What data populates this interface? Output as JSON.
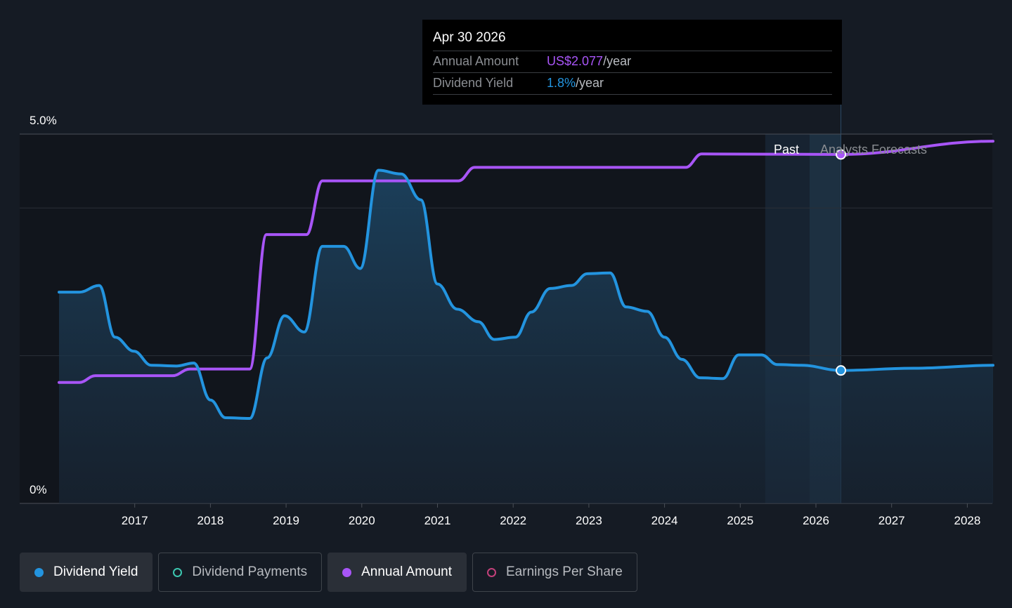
{
  "tooltip": {
    "date": "Apr 30 2026",
    "rows": [
      {
        "label": "Annual Amount",
        "value": "US$2.077",
        "unit": "/year",
        "color": "#a855f7"
      },
      {
        "label": "Dividend Yield",
        "value": "1.8%",
        "unit": "/year",
        "color": "#2394df"
      }
    ]
  },
  "chart_data": {
    "type": "line",
    "y_tick_labels": [
      "5.0%",
      "0%"
    ],
    "ylim": [
      0,
      5.0
    ],
    "yunit": "%",
    "x_tick_labels": [
      "2017",
      "2018",
      "2019",
      "2020",
      "2021",
      "2022",
      "2023",
      "2024",
      "2025",
      "2026",
      "2027",
      "2028"
    ],
    "xlim": [
      2016.0,
      2028.34
    ],
    "regions": {
      "past_label": "Past",
      "forecast_label": "Analysts Forecasts",
      "past_start": 2025.33,
      "forecast_start": 2026.33
    },
    "series": [
      {
        "name": "Dividend Yield",
        "color": "#2394df",
        "unit": "%",
        "x": [
          2016.0,
          2016.27,
          2016.53,
          2016.74,
          2016.99,
          2017.22,
          2017.55,
          2017.78,
          2018.0,
          2018.2,
          2018.52,
          2018.75,
          2018.98,
          2019.24,
          2019.48,
          2019.76,
          2019.98,
          2020.22,
          2020.52,
          2020.78,
          2021.0,
          2021.26,
          2021.54,
          2021.75,
          2022.03,
          2022.24,
          2022.49,
          2022.77,
          2022.98,
          2023.28,
          2023.49,
          2023.77,
          2024.0,
          2024.23,
          2024.47,
          2024.77,
          2024.98,
          2025.28,
          2025.49,
          2025.81,
          2026.33,
          2027.3,
          2028.34
        ],
        "values": [
          2.86,
          2.86,
          2.95,
          2.25,
          2.06,
          1.87,
          1.86,
          1.9,
          1.4,
          1.16,
          1.15,
          1.97,
          2.54,
          2.32,
          3.48,
          3.48,
          3.18,
          4.51,
          4.46,
          4.11,
          2.97,
          2.63,
          2.46,
          2.22,
          2.25,
          2.59,
          2.91,
          2.95,
          3.11,
          3.12,
          2.66,
          2.6,
          2.25,
          1.95,
          1.7,
          1.69,
          2.01,
          2.01,
          1.88,
          1.87,
          1.8,
          1.83,
          1.87
        ]
      },
      {
        "name": "Annual Amount",
        "color": "#a855f7",
        "unit": "US$",
        "x": [
          2016.0,
          2016.27,
          2016.48,
          2017.5,
          2017.73,
          2018.52,
          2018.74,
          2019.27,
          2019.48,
          2021.28,
          2021.49,
          2024.28,
          2024.49,
          2026.33,
          2028.34
        ],
        "values": [
          0.72,
          0.72,
          0.76,
          0.76,
          0.8,
          0.8,
          1.6,
          1.6,
          1.92,
          1.92,
          2.0,
          2.0,
          2.08,
          2.077,
          2.156
        ]
      }
    ],
    "highlight": {
      "x": 2026.33
    }
  },
  "legend": [
    {
      "label": "Dividend Yield",
      "active": true,
      "color": "#2394df"
    },
    {
      "label": "Dividend Payments",
      "active": false,
      "color": "#3cc7b0"
    },
    {
      "label": "Annual Amount",
      "active": true,
      "color": "#a855f7"
    },
    {
      "label": "Earnings Per Share",
      "active": false,
      "color": "#c2407a"
    }
  ]
}
